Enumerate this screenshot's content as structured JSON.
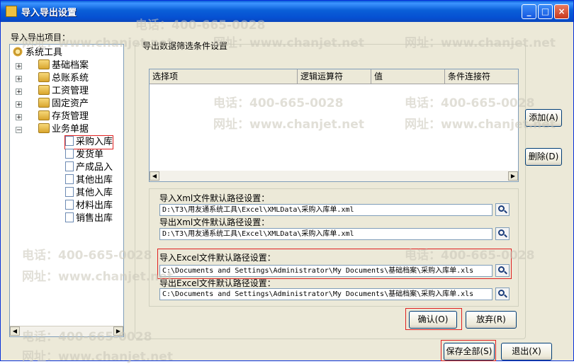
{
  "window": {
    "title": "导入导出设置",
    "min": "_",
    "max": "□",
    "close": "×"
  },
  "left_label": "导入导出项目：",
  "tree": {
    "root": "系统工具",
    "nodes": [
      "基础档案",
      "总账系统",
      "工资管理",
      "固定资产",
      "存货管理",
      "业务单据"
    ],
    "children": [
      "采购入库",
      "发货单",
      "产成品入",
      "其他出库",
      "其他入库",
      "材料出库",
      "销售出库"
    ]
  },
  "group_label": "导出数据筛选条件设置",
  "grid_columns": [
    "选择项",
    "逻辑运算符",
    "值",
    "条件连接符"
  ],
  "buttons": {
    "add": "添加(A)",
    "delete": "删除(D)",
    "confirm": "确认(O)",
    "cancel": "放弃(R)",
    "save_all": "保存全部(S)",
    "exit": "退出(X)"
  },
  "paths": {
    "import_xml_label": "导入Xml文件默认路径设置：",
    "import_xml": "D:\\T3\\用友通系统工具\\Excel\\XMLData\\采购入库单.xml",
    "export_xml_label": "导出Xml文件默认路径设置：",
    "export_xml": "D:\\T3\\用友通系统工具\\Excel\\XMLData\\采购入库单.xml",
    "import_excel_label": "导入Excel文件默认路径设置：",
    "import_excel": "C:\\Documents and Settings\\Administrator\\My Documents\\基础档案\\采购入库单.xls",
    "export_excel_label": "导出Excel文件默认路径设置：",
    "export_excel": "C:\\Documents and Settings\\Administrator\\My Documents\\基础档案\\采购入库单.xls"
  },
  "watermarks": [
    "电话：400-665-0028",
    "网址：www.chanjet.net"
  ]
}
